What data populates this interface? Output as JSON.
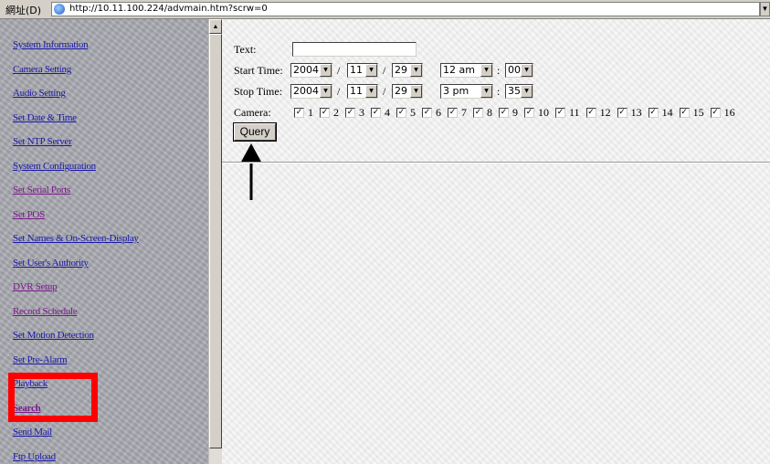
{
  "browser": {
    "address_label": "網址(D)",
    "url": "http://10.11.100.224/advmain.htm?scrw=0"
  },
  "sidebar": {
    "items": [
      {
        "label": "System Information"
      },
      {
        "label": "Camera Setting"
      },
      {
        "label": "Audio Setting"
      },
      {
        "label": "Set Date & Time"
      },
      {
        "label": "Set NTP Server"
      },
      {
        "label": "System Configuration"
      },
      {
        "label": "Set Serial Ports"
      },
      {
        "label": "Set POS"
      },
      {
        "label": "Set Names & On-Screen-Display"
      },
      {
        "label": "Set User's Authority"
      },
      {
        "label": "DVR Setup"
      },
      {
        "label": "Record Schedule"
      },
      {
        "label": "Set Motion Detection"
      },
      {
        "label": "Set Pre-Alarm"
      },
      {
        "label": "Playback"
      },
      {
        "label": "Search"
      },
      {
        "label": "Send Mail"
      },
      {
        "label": "Ftp Upload"
      }
    ]
  },
  "form": {
    "text_label": "Text:",
    "text_value": "",
    "start_label": "Start Time:",
    "start": {
      "year": "2004",
      "month": "11",
      "day": "29",
      "hour": "12 am",
      "minute": "00"
    },
    "stop_label": "Stop Time:",
    "stop": {
      "year": "2004",
      "month": "11",
      "day": "29",
      "hour": "3 pm",
      "minute": "35"
    },
    "date_sep": "/",
    "time_sep": ":",
    "camera_label": "Camera:",
    "cameras": [
      {
        "label": "1",
        "checked": true
      },
      {
        "label": "2",
        "checked": true
      },
      {
        "label": "3",
        "checked": true
      },
      {
        "label": "4",
        "checked": true
      },
      {
        "label": "5",
        "checked": true
      },
      {
        "label": "6",
        "checked": true
      },
      {
        "label": "7",
        "checked": true
      },
      {
        "label": "8",
        "checked": true
      },
      {
        "label": "9",
        "checked": true
      },
      {
        "label": "10",
        "checked": true
      },
      {
        "label": "11",
        "checked": true
      },
      {
        "label": "12",
        "checked": true
      },
      {
        "label": "13",
        "checked": true
      },
      {
        "label": "14",
        "checked": true
      },
      {
        "label": "15",
        "checked": true
      },
      {
        "label": "16",
        "checked": true
      }
    ],
    "query_label": "Query"
  },
  "colors": {
    "highlight": "#ff0000",
    "link": "#1a1aa8",
    "visited_link": "#7a1a8a"
  }
}
